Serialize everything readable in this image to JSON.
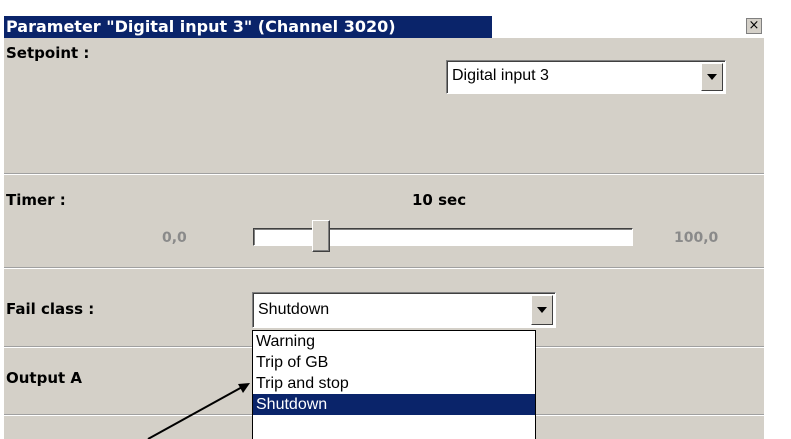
{
  "window": {
    "title": "Parameter \"Digital input 3\" (Channel 3020)",
    "close_symbol": "×"
  },
  "setpoint": {
    "label": "Setpoint :",
    "value": "Digital input 3"
  },
  "timer": {
    "label": "Timer :",
    "value_text": "10 sec",
    "min_label": "0,0",
    "max_label": "100,0",
    "value": 10,
    "min": 0,
    "max": 100
  },
  "fail_class": {
    "label": "Fail class :",
    "value": "Shutdown",
    "options": [
      "Warning",
      "Trip of GB",
      "Trip and stop",
      "Shutdown"
    ],
    "selected_index": 3
  },
  "output_a": {
    "label": "Output A"
  },
  "colors": {
    "dialog_bg": "#d4d0c8",
    "titlebar": "#0a246a",
    "selection": "#0a246a",
    "scale_text": "#8a8a8a"
  }
}
